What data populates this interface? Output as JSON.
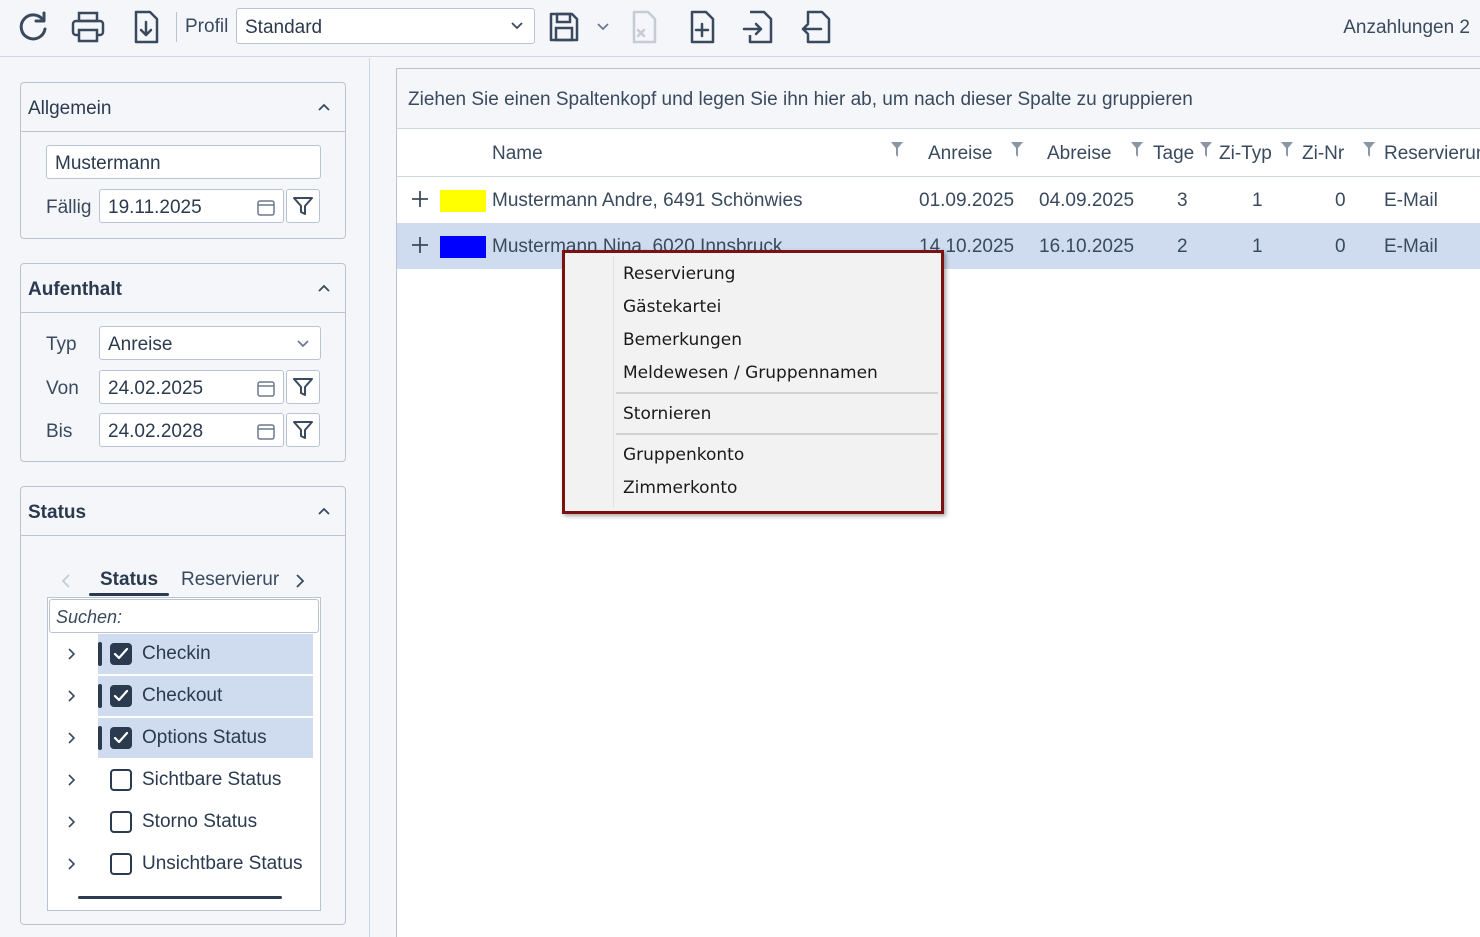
{
  "toolbar": {
    "profil_label": "Profil",
    "profil_value": "Standard",
    "anzahlungen": "Anzahlungen 2",
    "icons": [
      "refresh-icon",
      "print-icon",
      "export-download-icon",
      "save-icon",
      "dropdown-chevron-icon",
      "delete-file-icon",
      "new-file-icon",
      "import-file-icon",
      "export-file-icon"
    ]
  },
  "allgemein": {
    "title": "Allgemein",
    "name_value": "Mustermann",
    "faellig_label": "Fällig",
    "faellig_value": "19.11.2025"
  },
  "aufenthalt": {
    "title": "Aufenthalt",
    "typ_label": "Typ",
    "typ_value": "Anreise",
    "von_label": "Von",
    "von_value": "24.02.2025",
    "bis_label": "Bis",
    "bis_value": "24.02.2028"
  },
  "status": {
    "title": "Status",
    "tab_status": "Status",
    "tab_reservierung": "Reservierur",
    "search_placeholder": "Suchen:",
    "items": [
      {
        "label": "Checkin",
        "checked": true
      },
      {
        "label": "Checkout",
        "checked": true
      },
      {
        "label": "Options Status",
        "checked": true
      },
      {
        "label": "Sichtbare Status",
        "checked": false
      },
      {
        "label": "Storno Status",
        "checked": false
      },
      {
        "label": "Unsichtbare Status",
        "checked": false
      }
    ]
  },
  "grid": {
    "group_hint": "Ziehen Sie einen Spaltenkopf und legen Sie ihn hier ab, um nach dieser Spalte zu gruppieren",
    "columns": [
      "Name",
      "Anreise",
      "Abreise",
      "Tage",
      "Zi-Typ",
      "Zi-Nr",
      "Reservierun"
    ],
    "rows": [
      {
        "color": "#ffff00",
        "name": "Mustermann Andre, 6491 Schönwies",
        "anreise": "01.09.2025",
        "abreise": "04.09.2025",
        "tage": "3",
        "zityp": "1",
        "zinr": "0",
        "reservierung": "E-Mail"
      },
      {
        "color": "#0000ff",
        "name": "Mustermann Nina, 6020 Innsbruck",
        "anreise": "14.10.2025",
        "abreise": "16.10.2025",
        "tage": "2",
        "zityp": "1",
        "zinr": "0",
        "reservierung": "E-Mail"
      }
    ]
  },
  "context_menu": {
    "items": [
      "Reservierung",
      "Gästekartei",
      "Bemerkungen",
      "Meldewesen / Gruppennamen",
      "Stornieren",
      "Gruppenkonto",
      "Zimmerkonto"
    ]
  }
}
